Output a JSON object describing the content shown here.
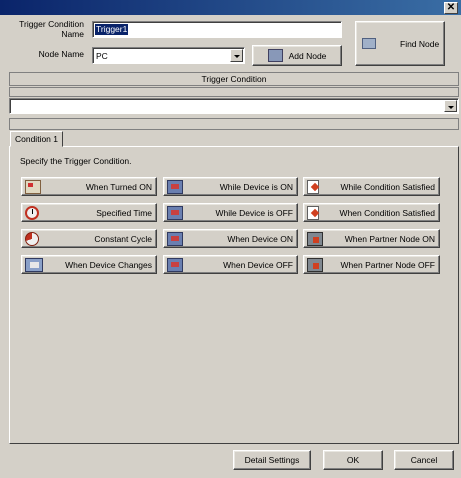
{
  "window": {
    "close_glyph": "✕"
  },
  "form": {
    "trigger_name_label": "Trigger Condition Name",
    "trigger_name_value": "Trigger1",
    "node_name_label": "Node Name",
    "node_name_value": "PC",
    "add_node_label": "Add Node",
    "find_node_label": "Find Node"
  },
  "trigger_condition_header": "Trigger Condition",
  "tabs": [
    {
      "label": "Condition 1"
    }
  ],
  "panel": {
    "instruction": "Specify the Trigger Condition."
  },
  "trigger_buttons": [
    {
      "label": "When Turned ON",
      "icon": "hand-switch-icon"
    },
    {
      "label": "While Device is ON",
      "icon": "screen-icon"
    },
    {
      "label": "While Condition Satisfied",
      "icon": "condition-doc-icon"
    },
    {
      "label": "Specified Time",
      "icon": "clock-icon"
    },
    {
      "label": "While Device is OFF",
      "icon": "screen-icon"
    },
    {
      "label": "When Condition Satisfied",
      "icon": "condition-doc-icon"
    },
    {
      "label": "Constant Cycle",
      "icon": "cycle-icon"
    },
    {
      "label": "When Device ON",
      "icon": "screen-icon"
    },
    {
      "label": "When Partner Node ON",
      "icon": "partner-node-icon"
    },
    {
      "label": "When Device Changes",
      "icon": "device-change-icon"
    },
    {
      "label": "When Device OFF",
      "icon": "screen-icon"
    },
    {
      "label": "When Partner Node OFF",
      "icon": "partner-node-icon"
    }
  ],
  "footer": {
    "detail_settings_label": "Detail Settings",
    "ok_label": "OK",
    "cancel_label": "Cancel"
  }
}
